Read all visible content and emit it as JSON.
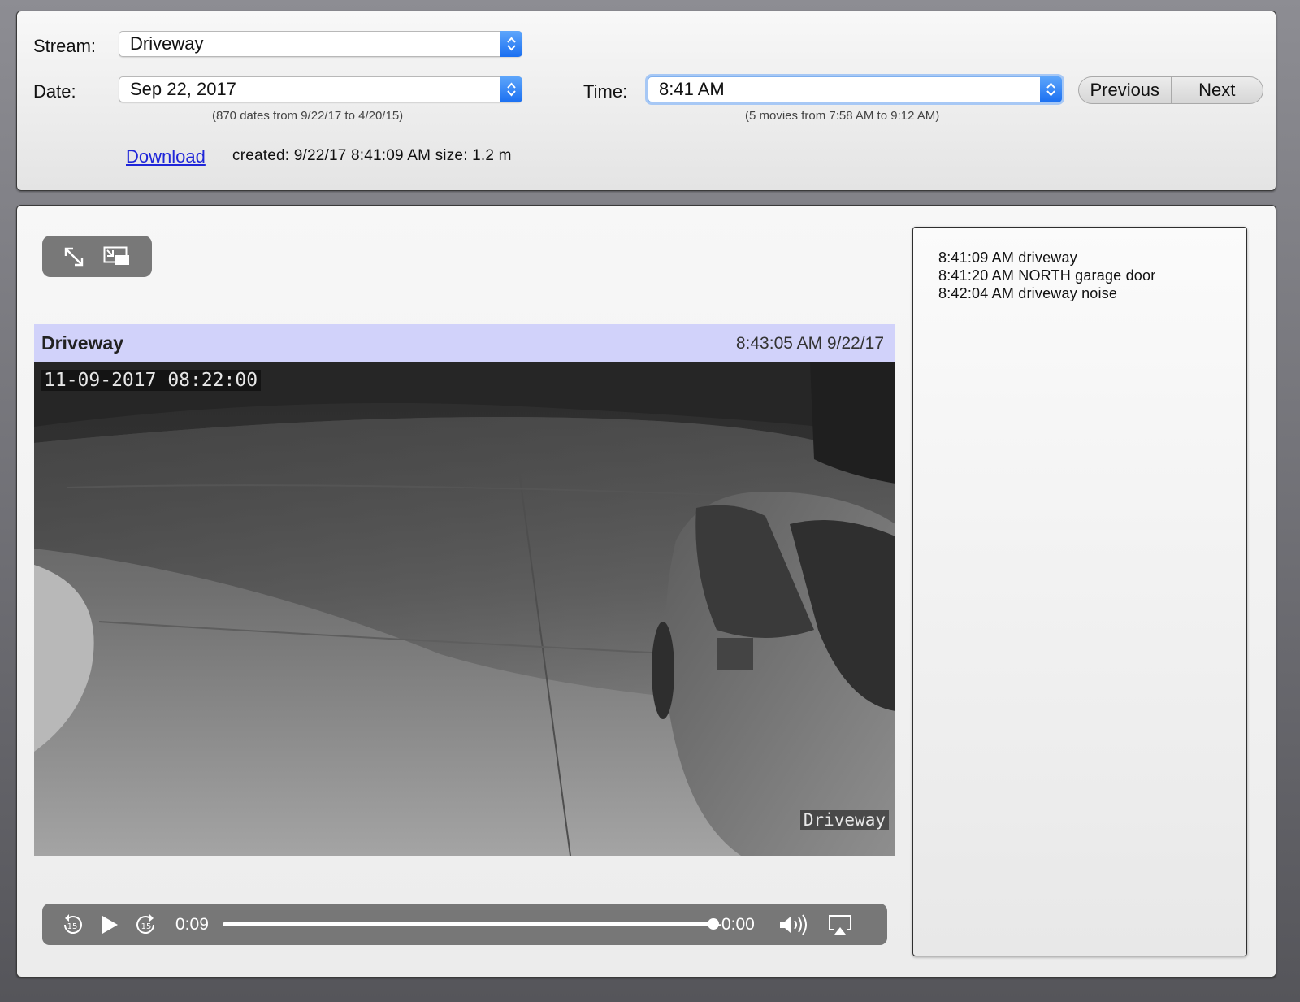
{
  "controls": {
    "stream_label": "Stream:",
    "stream_value": "Driveway",
    "date_label": "Date:",
    "date_value": "Sep 22, 2017",
    "date_hint": "(870 dates from 9/22/17 to 4/20/15)",
    "time_label": "Time:",
    "time_value": "8:41 AM",
    "time_hint": "(5 movies from 7:58 AM to 9:12 AM)",
    "previous_label": "Previous",
    "next_label": "Next",
    "download_label": "Download",
    "file_info": "created: 9/22/17 8:41:09 AM size: 1.2 m"
  },
  "video": {
    "title": "Driveway",
    "timestamp": "8:43:05 AM 9/22/17",
    "overlay_datetime": "11-09-2017 08:22:00",
    "overlay_camera": "Driveway"
  },
  "player": {
    "current_time": "0:09",
    "remaining_time": "-0:00",
    "progress": 1.0,
    "icons": [
      "rewind-15-icon",
      "play-icon",
      "forward-15-icon",
      "volume-icon",
      "airplay-icon"
    ]
  },
  "events": [
    {
      "text": "8:41:09 AM driveway"
    },
    {
      "text": "8:41:20 AM NORTH garage door"
    },
    {
      "text": "8:42:04 AM driveway noise"
    }
  ],
  "colors": {
    "accent_blue": "#1a6ff1",
    "header_bg": "#d1d2fa",
    "link": "#1f26d9"
  }
}
